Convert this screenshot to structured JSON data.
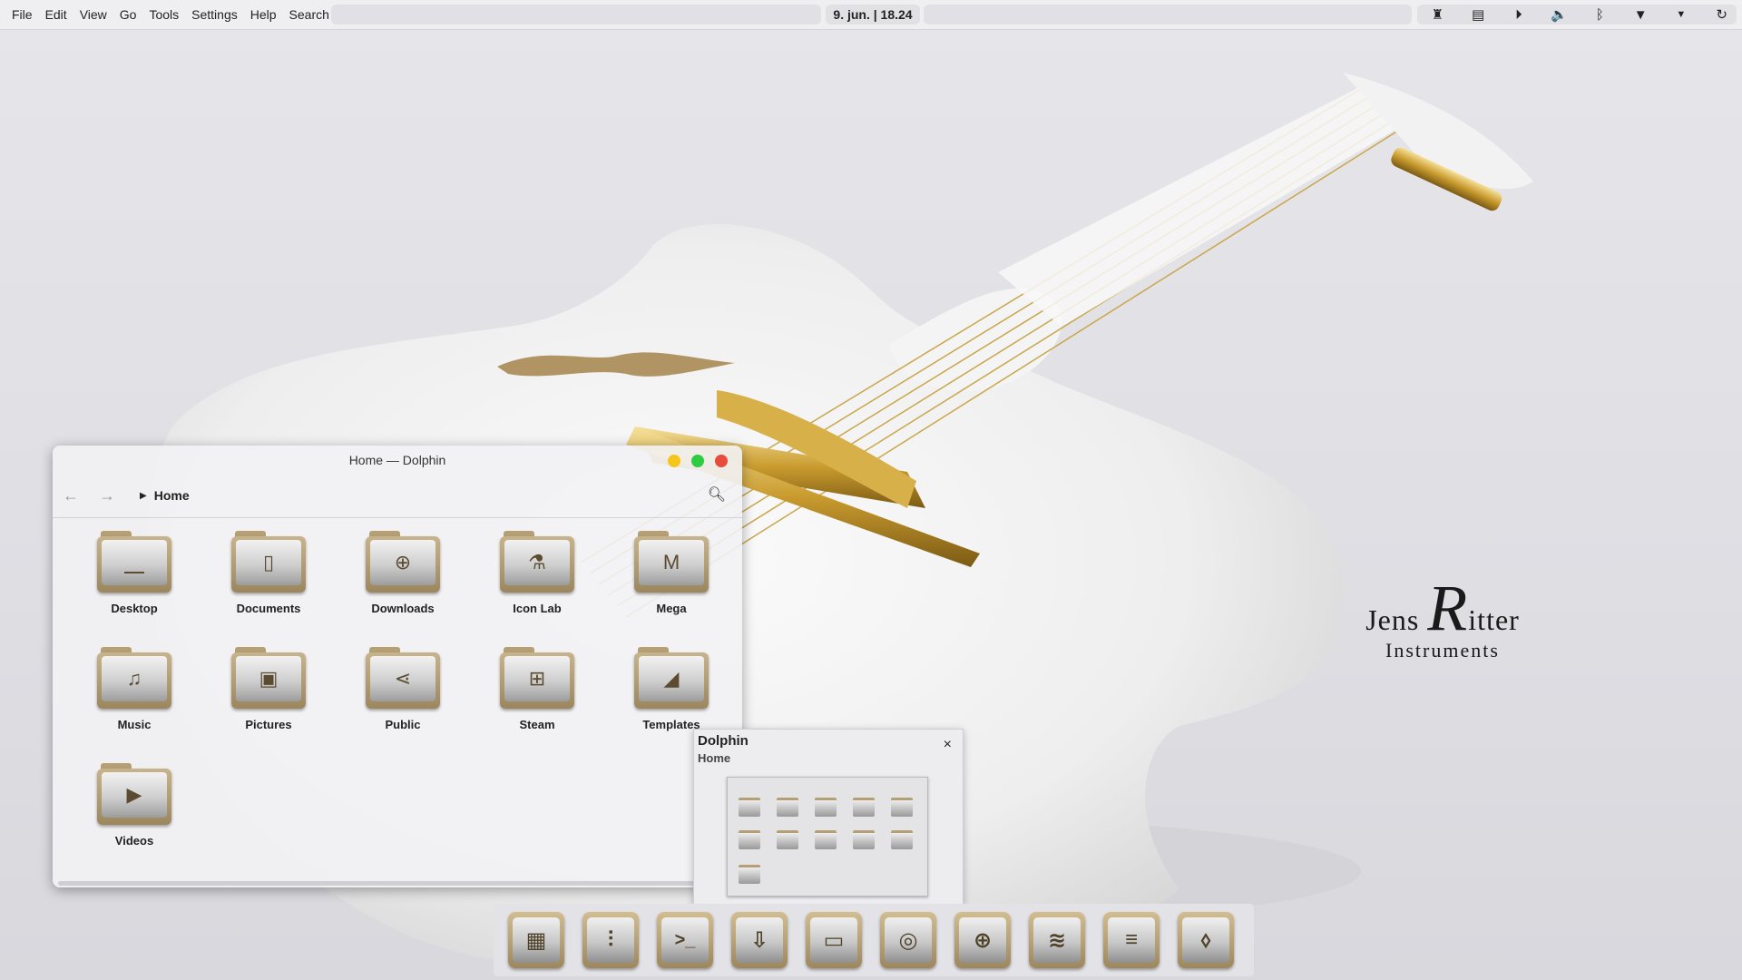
{
  "menubar": {
    "items": [
      "File",
      "Edit",
      "View",
      "Go",
      "Tools",
      "Settings",
      "Help",
      "Search"
    ]
  },
  "clock": {
    "text": "9. jun. | 18.24"
  },
  "tray": {
    "icons": [
      "notifications-icon",
      "clipboard-icon",
      "media-play-icon",
      "volume-icon",
      "bluetooth-icon",
      "wifi-icon",
      "expand-arrow-icon",
      "logout-icon"
    ]
  },
  "wallpaper": {
    "brand_line1_pre": "Jens ",
    "brand_big": "R",
    "brand_line1_post": "itter",
    "brand_line2": "Instruments"
  },
  "dolphin": {
    "title": "Home — Dolphin",
    "breadcrumb": "Home",
    "folders": [
      {
        "label": "Desktop",
        "glyph": "⎽"
      },
      {
        "label": "Documents",
        "glyph": "▯"
      },
      {
        "label": "Downloads",
        "glyph": "⊕"
      },
      {
        "label": "Icon Lab",
        "glyph": "⚗"
      },
      {
        "label": "Mega",
        "glyph": "M"
      },
      {
        "label": "Music",
        "glyph": "♫"
      },
      {
        "label": "Pictures",
        "glyph": "▣"
      },
      {
        "label": "Public",
        "glyph": "⋖"
      },
      {
        "label": "Steam",
        "glyph": "⊞"
      },
      {
        "label": "Templates",
        "glyph": "◢"
      },
      {
        "label": "Videos",
        "glyph": "▶"
      }
    ],
    "colors": {
      "close": "#e84c3d",
      "maximize": "#2ecc40",
      "minimize": "#f5c518"
    }
  },
  "preview": {
    "title": "Dolphin",
    "subtitle": "Home",
    "close": "×"
  },
  "dock": {
    "icons": [
      {
        "name": "app-grid-icon",
        "glyph": "▦"
      },
      {
        "name": "mixer-icon",
        "glyph": "⫶"
      },
      {
        "name": "terminal-icon",
        "glyph": ">_"
      },
      {
        "name": "package-installer-icon",
        "glyph": "⇩"
      },
      {
        "name": "file-manager-icon",
        "glyph": "▭"
      },
      {
        "name": "chrome-icon",
        "glyph": "◎"
      },
      {
        "name": "gamepad-icon",
        "glyph": "⊕"
      },
      {
        "name": "spotify-icon",
        "glyph": "≋"
      },
      {
        "name": "layers-icon",
        "glyph": "≡"
      },
      {
        "name": "store-icon",
        "glyph": "⬨"
      }
    ]
  }
}
